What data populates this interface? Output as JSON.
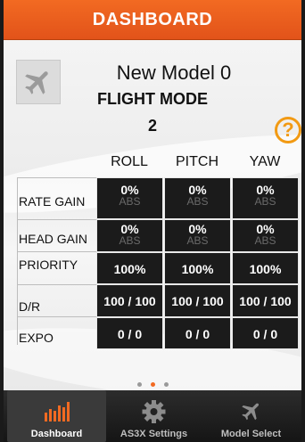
{
  "header": {
    "title": "DASHBOARD"
  },
  "model": {
    "name": "New Model  0"
  },
  "flight_mode": {
    "label": "FLIGHT MODE",
    "value": "2"
  },
  "help": {
    "label": "?"
  },
  "columns": [
    "ROLL",
    "PITCH",
    "YAW"
  ],
  "rows": [
    {
      "label": "RATE GAIN",
      "cells": [
        {
          "value": "0%",
          "sub": "ABS"
        },
        {
          "value": "0%",
          "sub": "ABS"
        },
        {
          "value": "0%",
          "sub": "ABS"
        }
      ]
    },
    {
      "label": "HEAD GAIN",
      "cells": [
        {
          "value": "0%",
          "sub": "ABS"
        },
        {
          "value": "0%",
          "sub": "ABS"
        },
        {
          "value": "0%",
          "sub": "ABS"
        }
      ]
    },
    {
      "label": "PRIORITY",
      "cells": [
        {
          "value": "100%"
        },
        {
          "value": "100%"
        },
        {
          "value": "100%"
        }
      ]
    },
    {
      "label": "D/R",
      "cells": [
        {
          "value": "100 / 100"
        },
        {
          "value": "100 / 100"
        },
        {
          "value": "100 / 100"
        }
      ]
    },
    {
      "label": "EXPO",
      "cells": [
        {
          "value": "0 / 0"
        },
        {
          "value": "0 / 0"
        },
        {
          "value": "0 / 0"
        }
      ]
    }
  ],
  "pager": {
    "count": 3,
    "active_index": 1
  },
  "tabs": [
    {
      "label": "Dashboard",
      "icon": "bar-chart-icon",
      "active": true
    },
    {
      "label": "AS3X Settings",
      "icon": "gear-icon",
      "active": false
    },
    {
      "label": "Model Select",
      "icon": "airplane-icon",
      "active": false
    }
  ],
  "colors": {
    "accent": "#f26a22",
    "help": "#f29a13",
    "cell_bg": "#1b1b1b",
    "tabbar": "#1d1d1d"
  }
}
